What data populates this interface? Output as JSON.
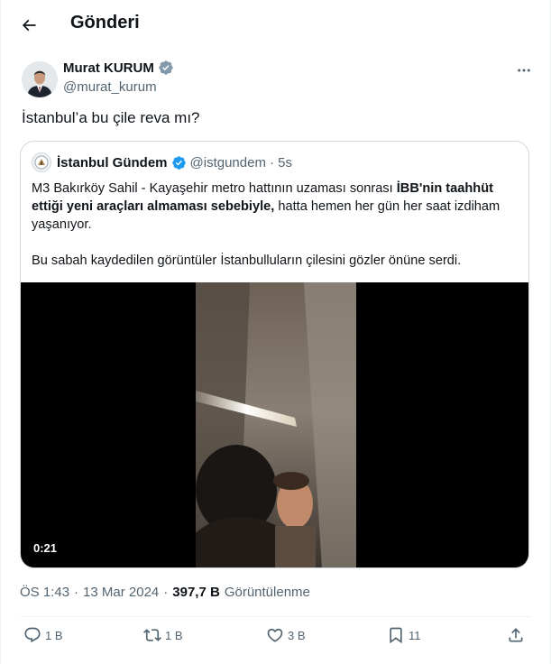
{
  "header": {
    "title": "Gönderi"
  },
  "author": {
    "name": "Murat KURUM",
    "handle": "@murat_kurum"
  },
  "tweet": {
    "text": "İstanbul’a bu çile reva mı?"
  },
  "quote": {
    "name": "İstanbul Gündem",
    "handle": "@istgundem",
    "time": "· 5s",
    "p1_part1": "M3 Bakırköy Sahil -  Kayaşehir metro hattının uzaması sonrası ",
    "p1_bold": "İBB'nin taahhüt ettiği yeni araçları almaması sebebiyle,",
    "p1_part2": " hatta hemen her gün her saat izdiham yaşanıyor.",
    "p2": "Bu sabah kaydedilen görüntüler İstanbulluların çilesini gözler önüne serdi.",
    "video_duration": "0:21"
  },
  "meta": {
    "time": "ÖS 1:43",
    "sep1": "·",
    "date": "13 Mar 2024",
    "sep2": "·",
    "views_count": "397,7 B",
    "views_label": "Görüntülenme"
  },
  "actions": {
    "replies": "1 B",
    "reposts": "1 B",
    "likes": "3 B",
    "bookmarks": "11"
  },
  "colors": {
    "verified": "#1d9bf0",
    "text": "#0f1419",
    "muted": "#536471",
    "border": "#cfd9de"
  }
}
